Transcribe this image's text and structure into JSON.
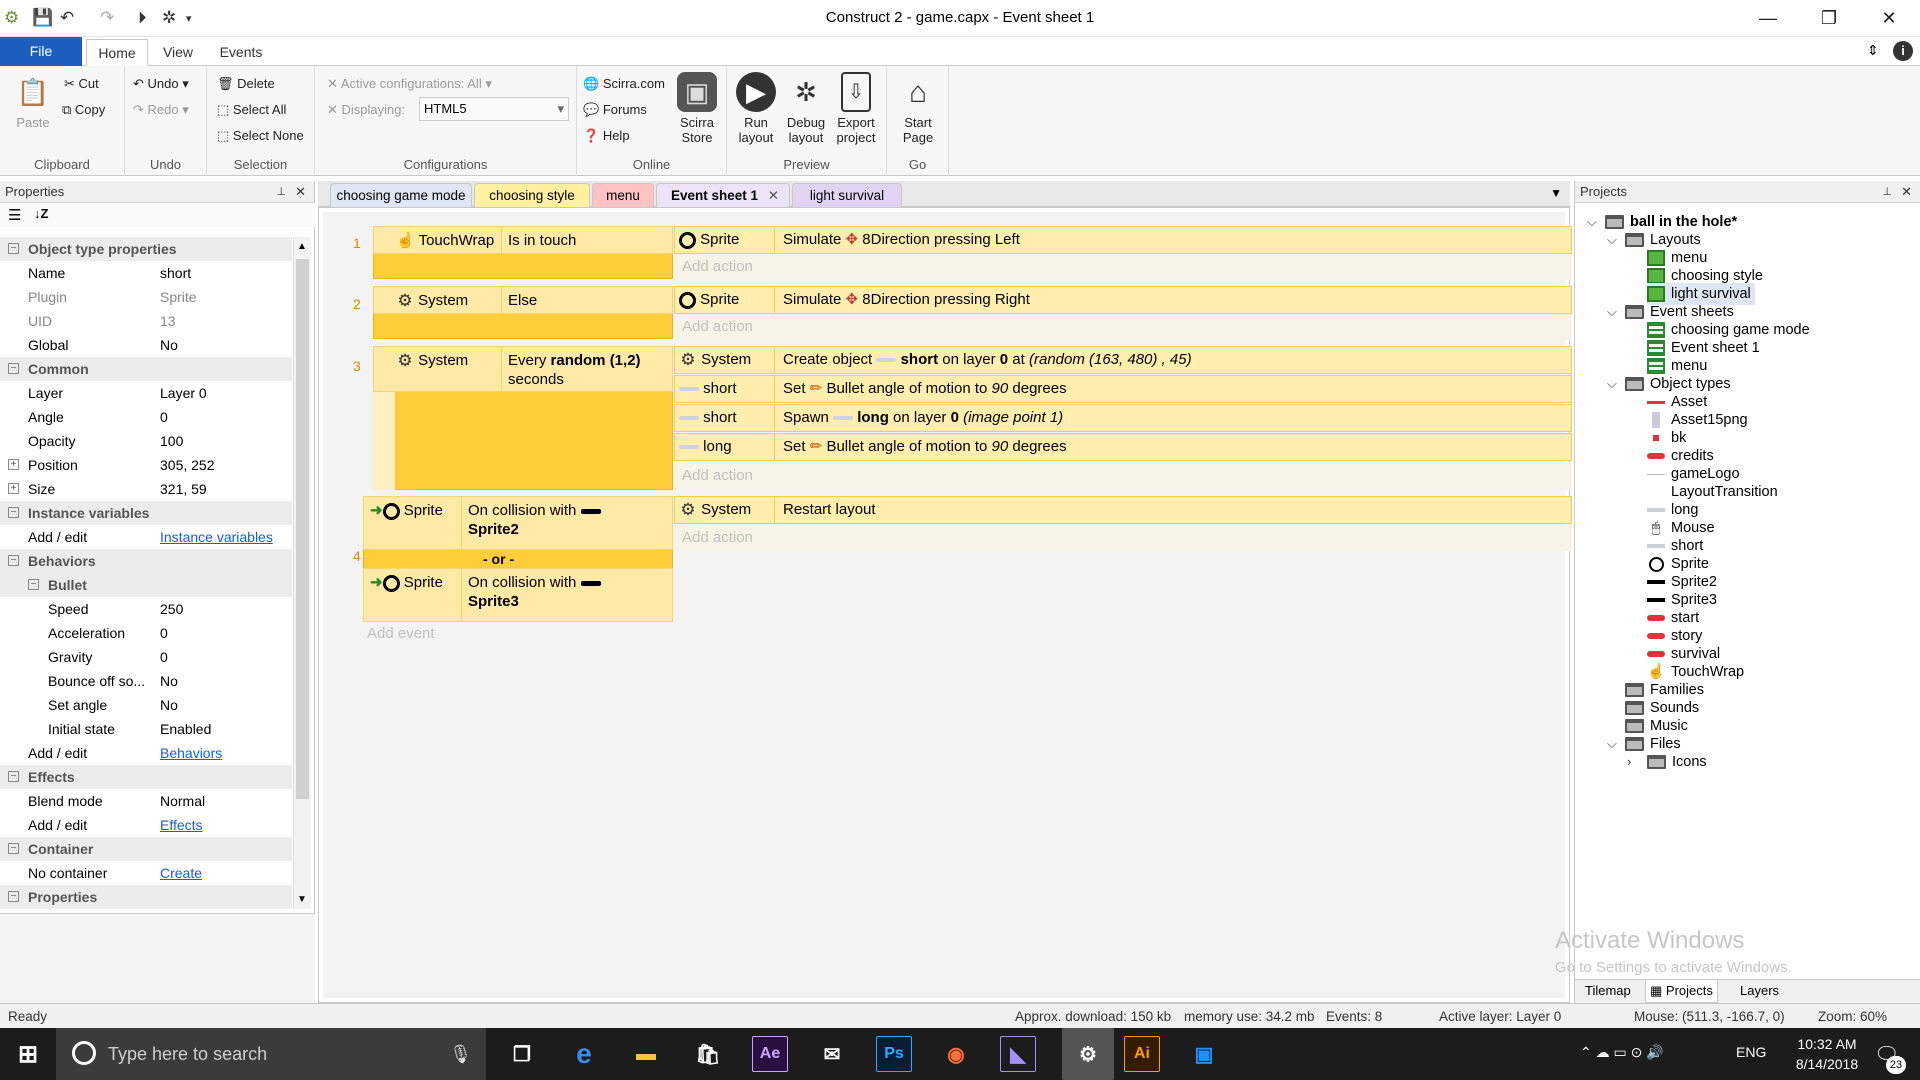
{
  "window": {
    "title": "Construct 2 - game.capx - Event sheet 1"
  },
  "ribbon_tabs": [
    "File",
    "Home",
    "View",
    "Events"
  ],
  "ribbon": {
    "clipboard": {
      "paste": "Paste",
      "cut": "Cut",
      "copy": "Copy",
      "label": "Clipboard"
    },
    "undo": {
      "undo": "Undo",
      "redo": "Redo",
      "label": "Undo"
    },
    "selection": {
      "delete": "Delete",
      "select_all": "Select All",
      "select_none": "Select None",
      "label": "Selection"
    },
    "configurations": {
      "active": "Active configurations: All",
      "displaying_label": "Displaying:",
      "displaying_value": "HTML5",
      "label": "Configurations"
    },
    "online": {
      "scirra": "Scirra.com",
      "forums": "Forums",
      "help": "Help",
      "store_line1": "Scirra",
      "store_line2": "Store",
      "label": "Online"
    },
    "preview": {
      "run_1": "Run",
      "run_2": "layout",
      "debug_1": "Debug",
      "debug_2": "layout",
      "export_1": "Export",
      "export_2": "project",
      "label": "Preview"
    },
    "go": {
      "start_1": "Start",
      "start_2": "Page",
      "label": "Go"
    }
  },
  "properties": {
    "title": "Properties",
    "rows": [
      {
        "k": "Object type properties",
        "v": "",
        "cat": true
      },
      {
        "k": "Name",
        "v": "short"
      },
      {
        "k": "Plugin",
        "v": "Sprite",
        "gray": true
      },
      {
        "k": "UID",
        "v": "13",
        "gray": true
      },
      {
        "k": "Global",
        "v": "No"
      },
      {
        "k": "Common",
        "v": "",
        "cat": true
      },
      {
        "k": "Layer",
        "v": "Layer 0"
      },
      {
        "k": "Angle",
        "v": "0"
      },
      {
        "k": "Opacity",
        "v": "100"
      },
      {
        "k": "Position",
        "v": "305, 252",
        "exp": true
      },
      {
        "k": "Size",
        "v": "321, 59",
        "exp": true
      },
      {
        "k": "Instance variables",
        "v": "",
        "cat": true
      },
      {
        "k": "Add / edit",
        "v": "Instance variables",
        "link": true
      },
      {
        "k": "Behaviors",
        "v": "",
        "cat": true
      },
      {
        "k": "Bullet",
        "v": "",
        "cat": true,
        "sub": true
      },
      {
        "k": "Speed",
        "v": "250",
        "indent": true
      },
      {
        "k": "Acceleration",
        "v": "0",
        "indent": true
      },
      {
        "k": "Gravity",
        "v": "0",
        "indent": true
      },
      {
        "k": "Bounce off so...",
        "v": "No",
        "indent": true
      },
      {
        "k": "Set angle",
        "v": "No",
        "indent": true
      },
      {
        "k": "Initial state",
        "v": "Enabled",
        "indent": true
      },
      {
        "k": "Add / edit",
        "v": "Behaviors",
        "link": true
      },
      {
        "k": "Effects",
        "v": "",
        "cat": true
      },
      {
        "k": "Blend mode",
        "v": "Normal"
      },
      {
        "k": "Add / edit",
        "v": "Effects",
        "link": true
      },
      {
        "k": "Container",
        "v": "",
        "cat": true
      },
      {
        "k": "No container",
        "v": "Create",
        "link": true
      },
      {
        "k": "Properties",
        "v": "",
        "cat": true
      }
    ]
  },
  "doc_tabs": [
    "choosing game mode",
    "choosing style",
    "menu",
    "Event sheet 1",
    "light survival"
  ],
  "events": {
    "e1": {
      "num": "1",
      "obj": "TouchWrap",
      "cond": "Is in touch",
      "a_obj": "Sprite",
      "a_pre": "Simulate",
      "a_txt": "8Direction pressing Left"
    },
    "e2": {
      "num": "2",
      "obj": "System",
      "cond": "Else",
      "a_obj": "Sprite",
      "a_pre": "Simulate",
      "a_txt": "8Direction pressing Right"
    },
    "e3": {
      "num": "3",
      "obj": "System",
      "cond_a": "Every",
      "cond_b": "random (1,2)",
      "cond_c": "seconds",
      "a1_obj": "System",
      "a1_a": "Create object",
      "a1_b": "short",
      "a1_c": "on layer",
      "a1_d": "0",
      "a1_e": "at",
      "a1_f": "(random (163, 480) , 45)",
      "a2_obj": "short",
      "a2_a": "Set",
      "a2_b": "Bullet angle of motion to",
      "a2_c": "90",
      "a2_d": "degrees",
      "a3_obj": "short",
      "a3_a": "Spawn",
      "a3_b": "long",
      "a3_c": "on layer",
      "a3_d": "0",
      "a3_e": "(image point 1)",
      "a4_obj": "long",
      "a4_a": "Set",
      "a4_b": "Bullet angle of motion to",
      "a4_c": "90",
      "a4_d": "degrees"
    },
    "e4": {
      "num": "4",
      "c1_obj": "Sprite",
      "c1_a": "On collision with",
      "c1_b": "Sprite2",
      "or": "- or -",
      "c2_obj": "Sprite",
      "c2_a": "On collision with",
      "c2_b": "Sprite3",
      "a_obj": "System",
      "a_txt": "Restart layout"
    },
    "add_action": "Add action",
    "add_event": "Add event"
  },
  "projects": {
    "title": "Projects",
    "root": "ball in the hole*",
    "layouts": "Layouts",
    "layout_items": [
      "menu",
      "choosing style",
      "light survival"
    ],
    "event_sheets": "Event sheets",
    "sheet_items": [
      "choosing game mode",
      "Event sheet 1",
      "menu"
    ],
    "object_types": "Object types",
    "objects": [
      "Asset",
      "Asset15png",
      "bk",
      "credits",
      "gameLogo",
      "LayoutTransition",
      "long",
      "Mouse",
      "short",
      "Sprite",
      "Sprite2",
      "Sprite3",
      "start",
      "story",
      "survival",
      "TouchWrap"
    ],
    "families": "Families",
    "sounds": "Sounds",
    "music": "Music",
    "files": "Files",
    "icons": "Icons",
    "bottom_tabs": [
      "Tilemap",
      "Projects",
      "Layers"
    ]
  },
  "watermark": {
    "line1": "Activate Windows",
    "line2": "Go to Settings to activate Windows."
  },
  "status": {
    "ready": "Ready",
    "download": "Approx. download: 150 kb",
    "memory": "memory use: 34.2 mb",
    "events": "Events: 8",
    "layer": "Active layer: Layer 0",
    "mouse": "Mouse: (511.3, -166.7, 0)",
    "zoom": "Zoom: 60%"
  },
  "taskbar": {
    "search_placeholder": "Type here to search",
    "lang": "ENG",
    "time": "10:32 AM",
    "date": "8/14/2018",
    "notif": "23"
  }
}
